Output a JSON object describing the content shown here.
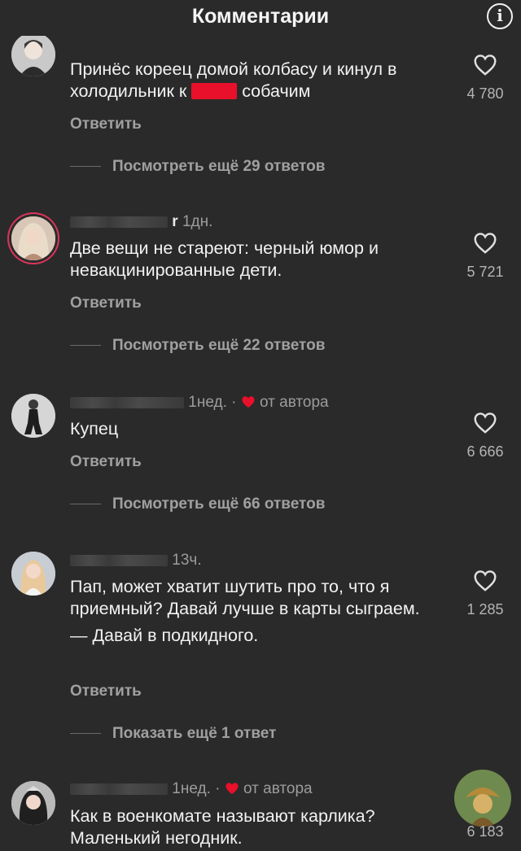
{
  "header": {
    "title": "Комментарии",
    "info_glyph": "i"
  },
  "comments": [
    {
      "time": "",
      "text_before": "Принёс кореец домой колбасу и кинул в холодильник к ",
      "text_after": " собачим",
      "reply_label": "Ответить",
      "more_replies": "Посмотреть ещё 29 ответов",
      "likes": "4 780"
    },
    {
      "name_tail": "r",
      "time": "1дн.",
      "text": "Две вещи не стареют: черный юмор и невакцинированные дети.",
      "reply_label": "Ответить",
      "more_replies": "Посмотреть ещё 22 ответов",
      "likes": "5 721"
    },
    {
      "name_tail": "",
      "time": "1нед. ·",
      "author_label": "от автора",
      "text": "Купец",
      "reply_label": "Ответить",
      "more_replies": "Посмотреть ещё 66 ответов",
      "likes": "6 666"
    },
    {
      "name_tail": "",
      "time": "13ч.",
      "text": "Пап, может хватит шутить про то, что я приемный? Давай лучше в карты сыграем.",
      "text2": "— Давай в подкидного.",
      "reply_label": "Ответить",
      "more_replies": "Показать ещё 1 ответ",
      "likes": "1 285"
    },
    {
      "name_tail": "",
      "time": "1нед. ·",
      "author_label": "от автора",
      "text": "Как в военкомате называют карлика? Маленький негодник.",
      "likes": "6 183"
    }
  ],
  "colors": {
    "background": "#2a2a2a",
    "author_heart": "#e8102a",
    "story_ring": "#d9355a"
  },
  "icons": [
    "info-icon",
    "heart-outline-icon",
    "heart-filled-icon"
  ]
}
